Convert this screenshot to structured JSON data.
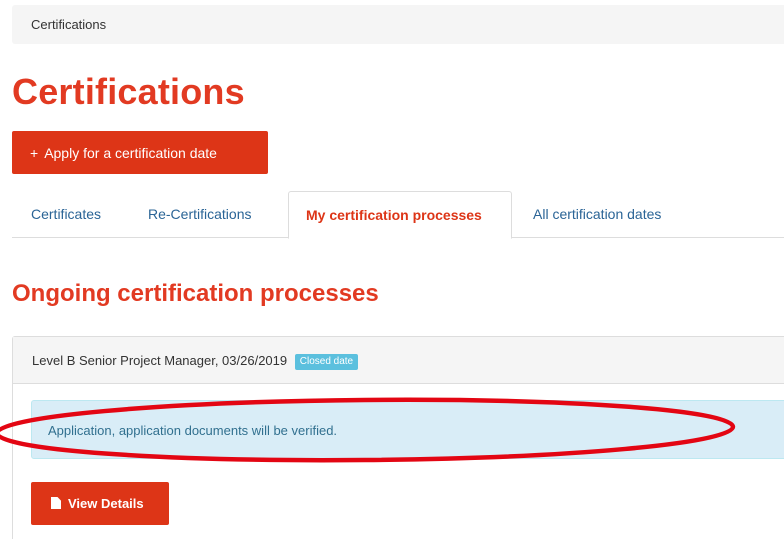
{
  "breadcrumb": {
    "label": "Certifications"
  },
  "page": {
    "title": "Certifications"
  },
  "apply_button": {
    "icon": "plus-icon",
    "label": "Apply for a certification date"
  },
  "tabs": [
    {
      "label": "Certificates",
      "active": false
    },
    {
      "label": "Re-Certifications",
      "active": false
    },
    {
      "label": "My certification processes",
      "active": true
    },
    {
      "label": "All certification dates",
      "active": false
    }
  ],
  "section": {
    "title": "Ongoing certification processes"
  },
  "process_panel": {
    "heading": "Level B Senior Project Manager, 03/26/2019",
    "badge": "Closed date",
    "alert": "Application, application documents will be verified.",
    "details_button": {
      "icon": "document-icon",
      "label": "View Details"
    }
  },
  "colors": {
    "brand": "#dd3517",
    "heading": "#e23a22",
    "link": "#2a6496",
    "badge": "#5bc0de",
    "alert_bg": "#d9edf7",
    "annotation": "#e30613"
  }
}
